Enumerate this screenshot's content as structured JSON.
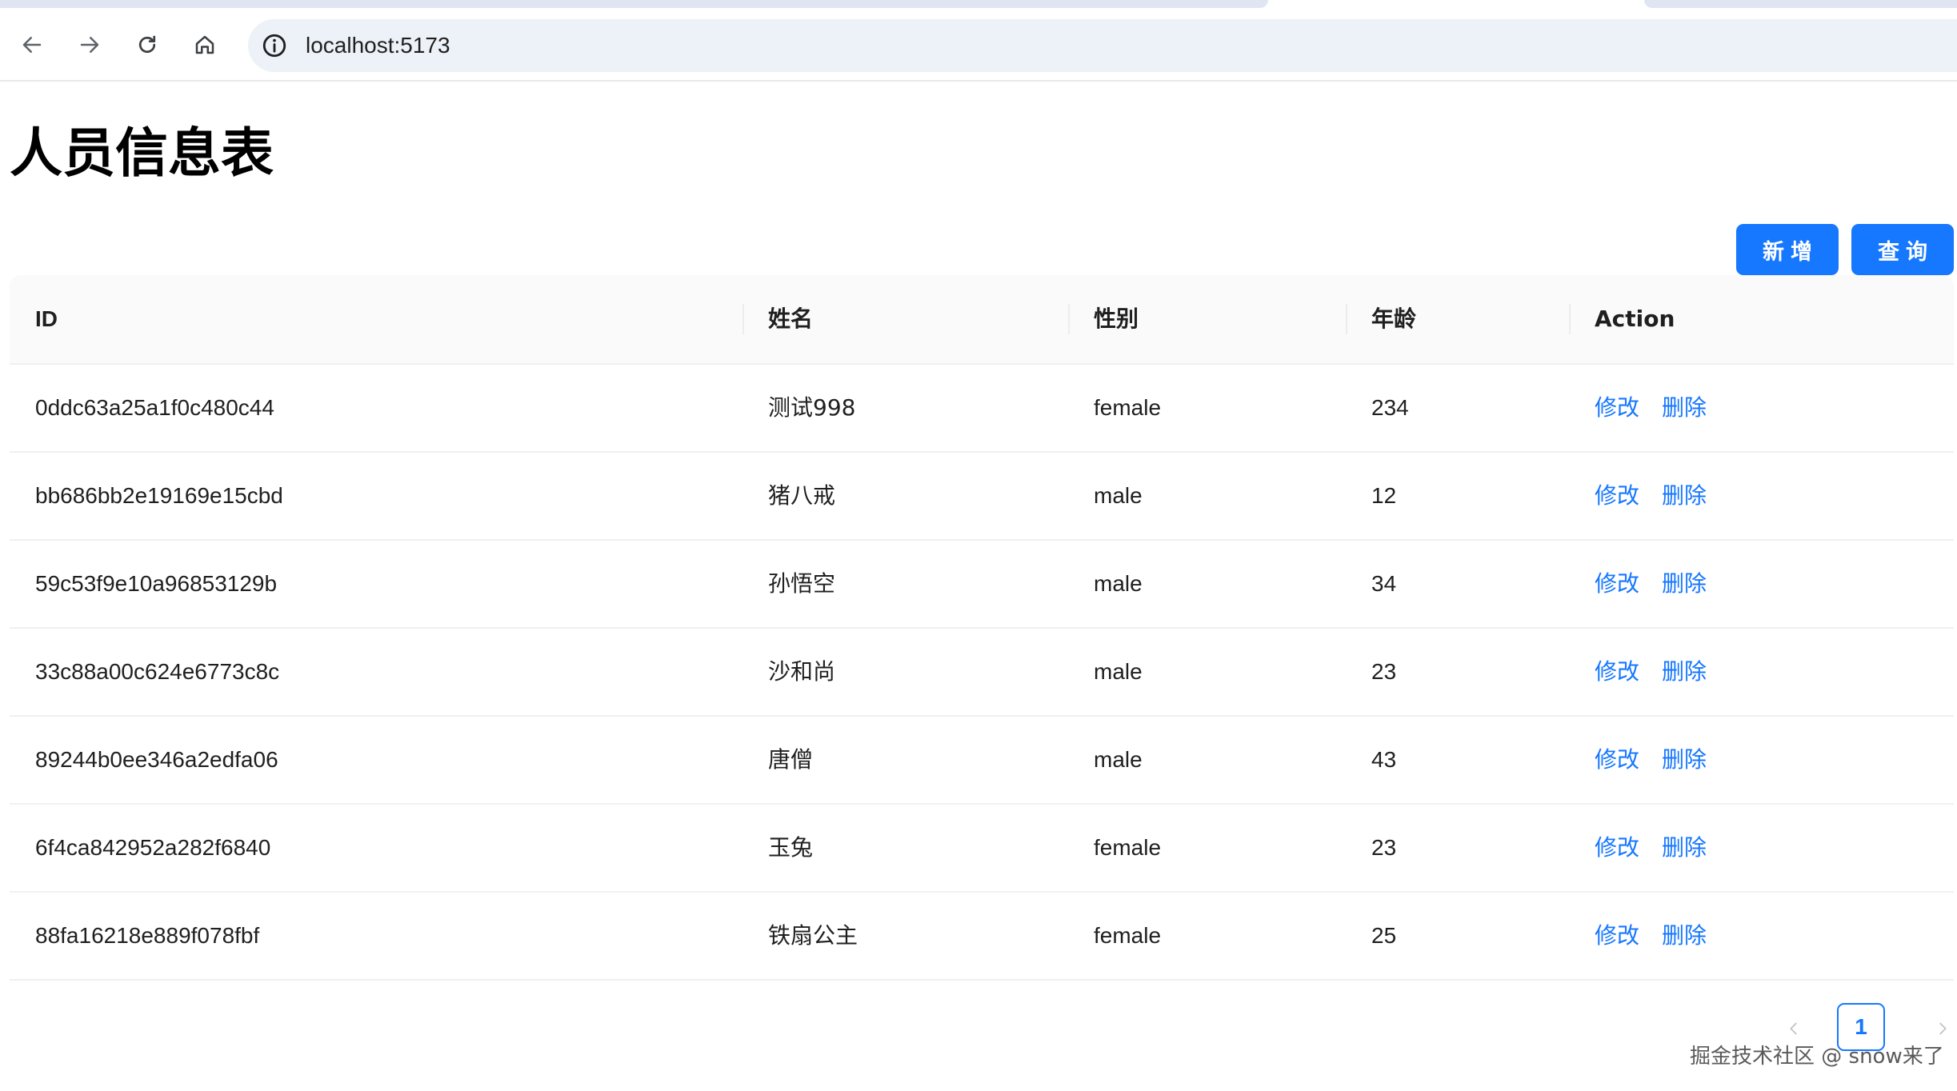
{
  "browser": {
    "url": "localhost:5173",
    "icons": [
      "back-arrow-icon",
      "forward-arrow-icon",
      "reload-icon",
      "home-icon",
      "info-icon"
    ]
  },
  "page": {
    "title": "人员信息表",
    "add_label": "新增",
    "query_label": "查询"
  },
  "table": {
    "columns": [
      "ID",
      "姓名",
      "性别",
      "年龄",
      "Action"
    ],
    "rows": [
      {
        "id": "0ddc63a25a1f0c480c44",
        "name": "测试998",
        "gender": "female",
        "age": "234"
      },
      {
        "id": "bb686bb2e19169e15cbd",
        "name": "猪八戒",
        "gender": "male",
        "age": "12"
      },
      {
        "id": "59c53f9e10a96853129b",
        "name": "孙悟空",
        "gender": "male",
        "age": "34"
      },
      {
        "id": "33c88a00c624e6773c8c",
        "name": "沙和尚",
        "gender": "male",
        "age": "23"
      },
      {
        "id": "89244b0ee346a2edfa06",
        "name": "唐僧",
        "gender": "male",
        "age": "43"
      },
      {
        "id": "6f4ca842952a282f6840",
        "name": "玉兔",
        "gender": "female",
        "age": "23"
      },
      {
        "id": "88fa16218e889f078fbf",
        "name": "铁扇公主",
        "gender": "female",
        "age": "25"
      }
    ],
    "edit_label": "修改",
    "delete_label": "删除"
  },
  "pagination": {
    "current_page": "1"
  },
  "watermark": "掘金技术社区 @ snow来了",
  "colors": {
    "primary": "#1677ff",
    "header_bg": "#fafafa",
    "omnibox_bg": "#edf1f8"
  }
}
